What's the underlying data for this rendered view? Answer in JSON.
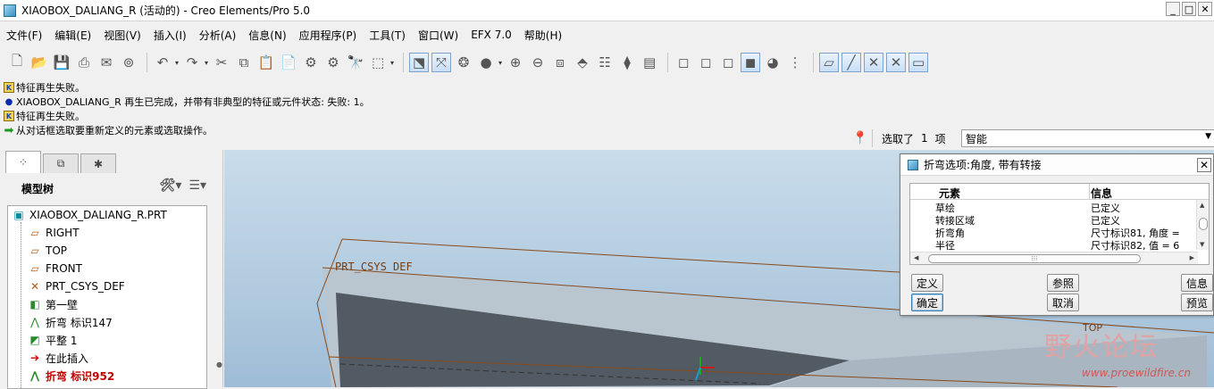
{
  "window": {
    "title": "XIAOBOX_DALIANG_R (活动的) - Creo Elements/Pro 5.0",
    "controls": [
      "_",
      "□",
      "✕"
    ]
  },
  "menu": [
    "文件(F)",
    "编辑(E)",
    "视图(V)",
    "插入(I)",
    "分析(A)",
    "信息(N)",
    "应用程序(P)",
    "工具(T)",
    "窗口(W)",
    "EFX 7.0",
    "帮助(H)"
  ],
  "messages": [
    {
      "icon": "warning-icon",
      "text": "特征再生失败。"
    },
    {
      "icon": "info-dot-icon",
      "text": "XIAOBOX_DALIANG_R 再生已完成，并带有非典型的特征或元件状态: 失败: 1。"
    },
    {
      "icon": "warning-icon",
      "text": "特征再生失败。"
    },
    {
      "icon": "prompt-arrow-icon",
      "text": "从对话框选取要重新定义的元素或选取操作。"
    }
  ],
  "selection": {
    "label": "选取了",
    "count": "1",
    "unit": "项",
    "filter": "智能"
  },
  "model_tree": {
    "title": "模型树",
    "items": [
      {
        "label": "XIAOBOX_DALIANG_R.PRT",
        "icon": "part-icon"
      },
      {
        "label": "RIGHT",
        "icon": "datum-plane-icon"
      },
      {
        "label": "TOP",
        "icon": "datum-plane-icon"
      },
      {
        "label": "FRONT",
        "icon": "datum-plane-icon"
      },
      {
        "label": "PRT_CSYS_DEF",
        "icon": "csys-icon"
      },
      {
        "label": "第一壁",
        "icon": "sheetmetal-wall-icon"
      },
      {
        "label": "折弯 标识147",
        "icon": "bend-icon"
      },
      {
        "label": "平整 1",
        "icon": "unbend-icon"
      },
      {
        "label": "在此插入",
        "icon": "insert-here-icon"
      },
      {
        "label": "折弯 标识952",
        "icon": "bend-failed-icon"
      }
    ]
  },
  "viewport": {
    "csys_label": "PRT_CSYS_DEF",
    "plane_label": "TOP",
    "watermark": "野火论坛",
    "watermark_url": "www.proewildfire.cn"
  },
  "dialog": {
    "title": "折弯选项:角度, 带有转接",
    "col_element": "元素",
    "col_info": "信息",
    "rows": [
      {
        "element": "草绘",
        "info": "已定义"
      },
      {
        "element": "转接区域",
        "info": "已定义"
      },
      {
        "element": "折弯角",
        "info": "尺寸标识81, 角度 ="
      },
      {
        "element": "半径",
        "info": "尺寸标识82, 值 = 6"
      }
    ],
    "buttons": {
      "define": "定义",
      "refs": "参照",
      "info": "信息",
      "ok": "确定",
      "cancel": "取消",
      "preview": "预览"
    }
  }
}
